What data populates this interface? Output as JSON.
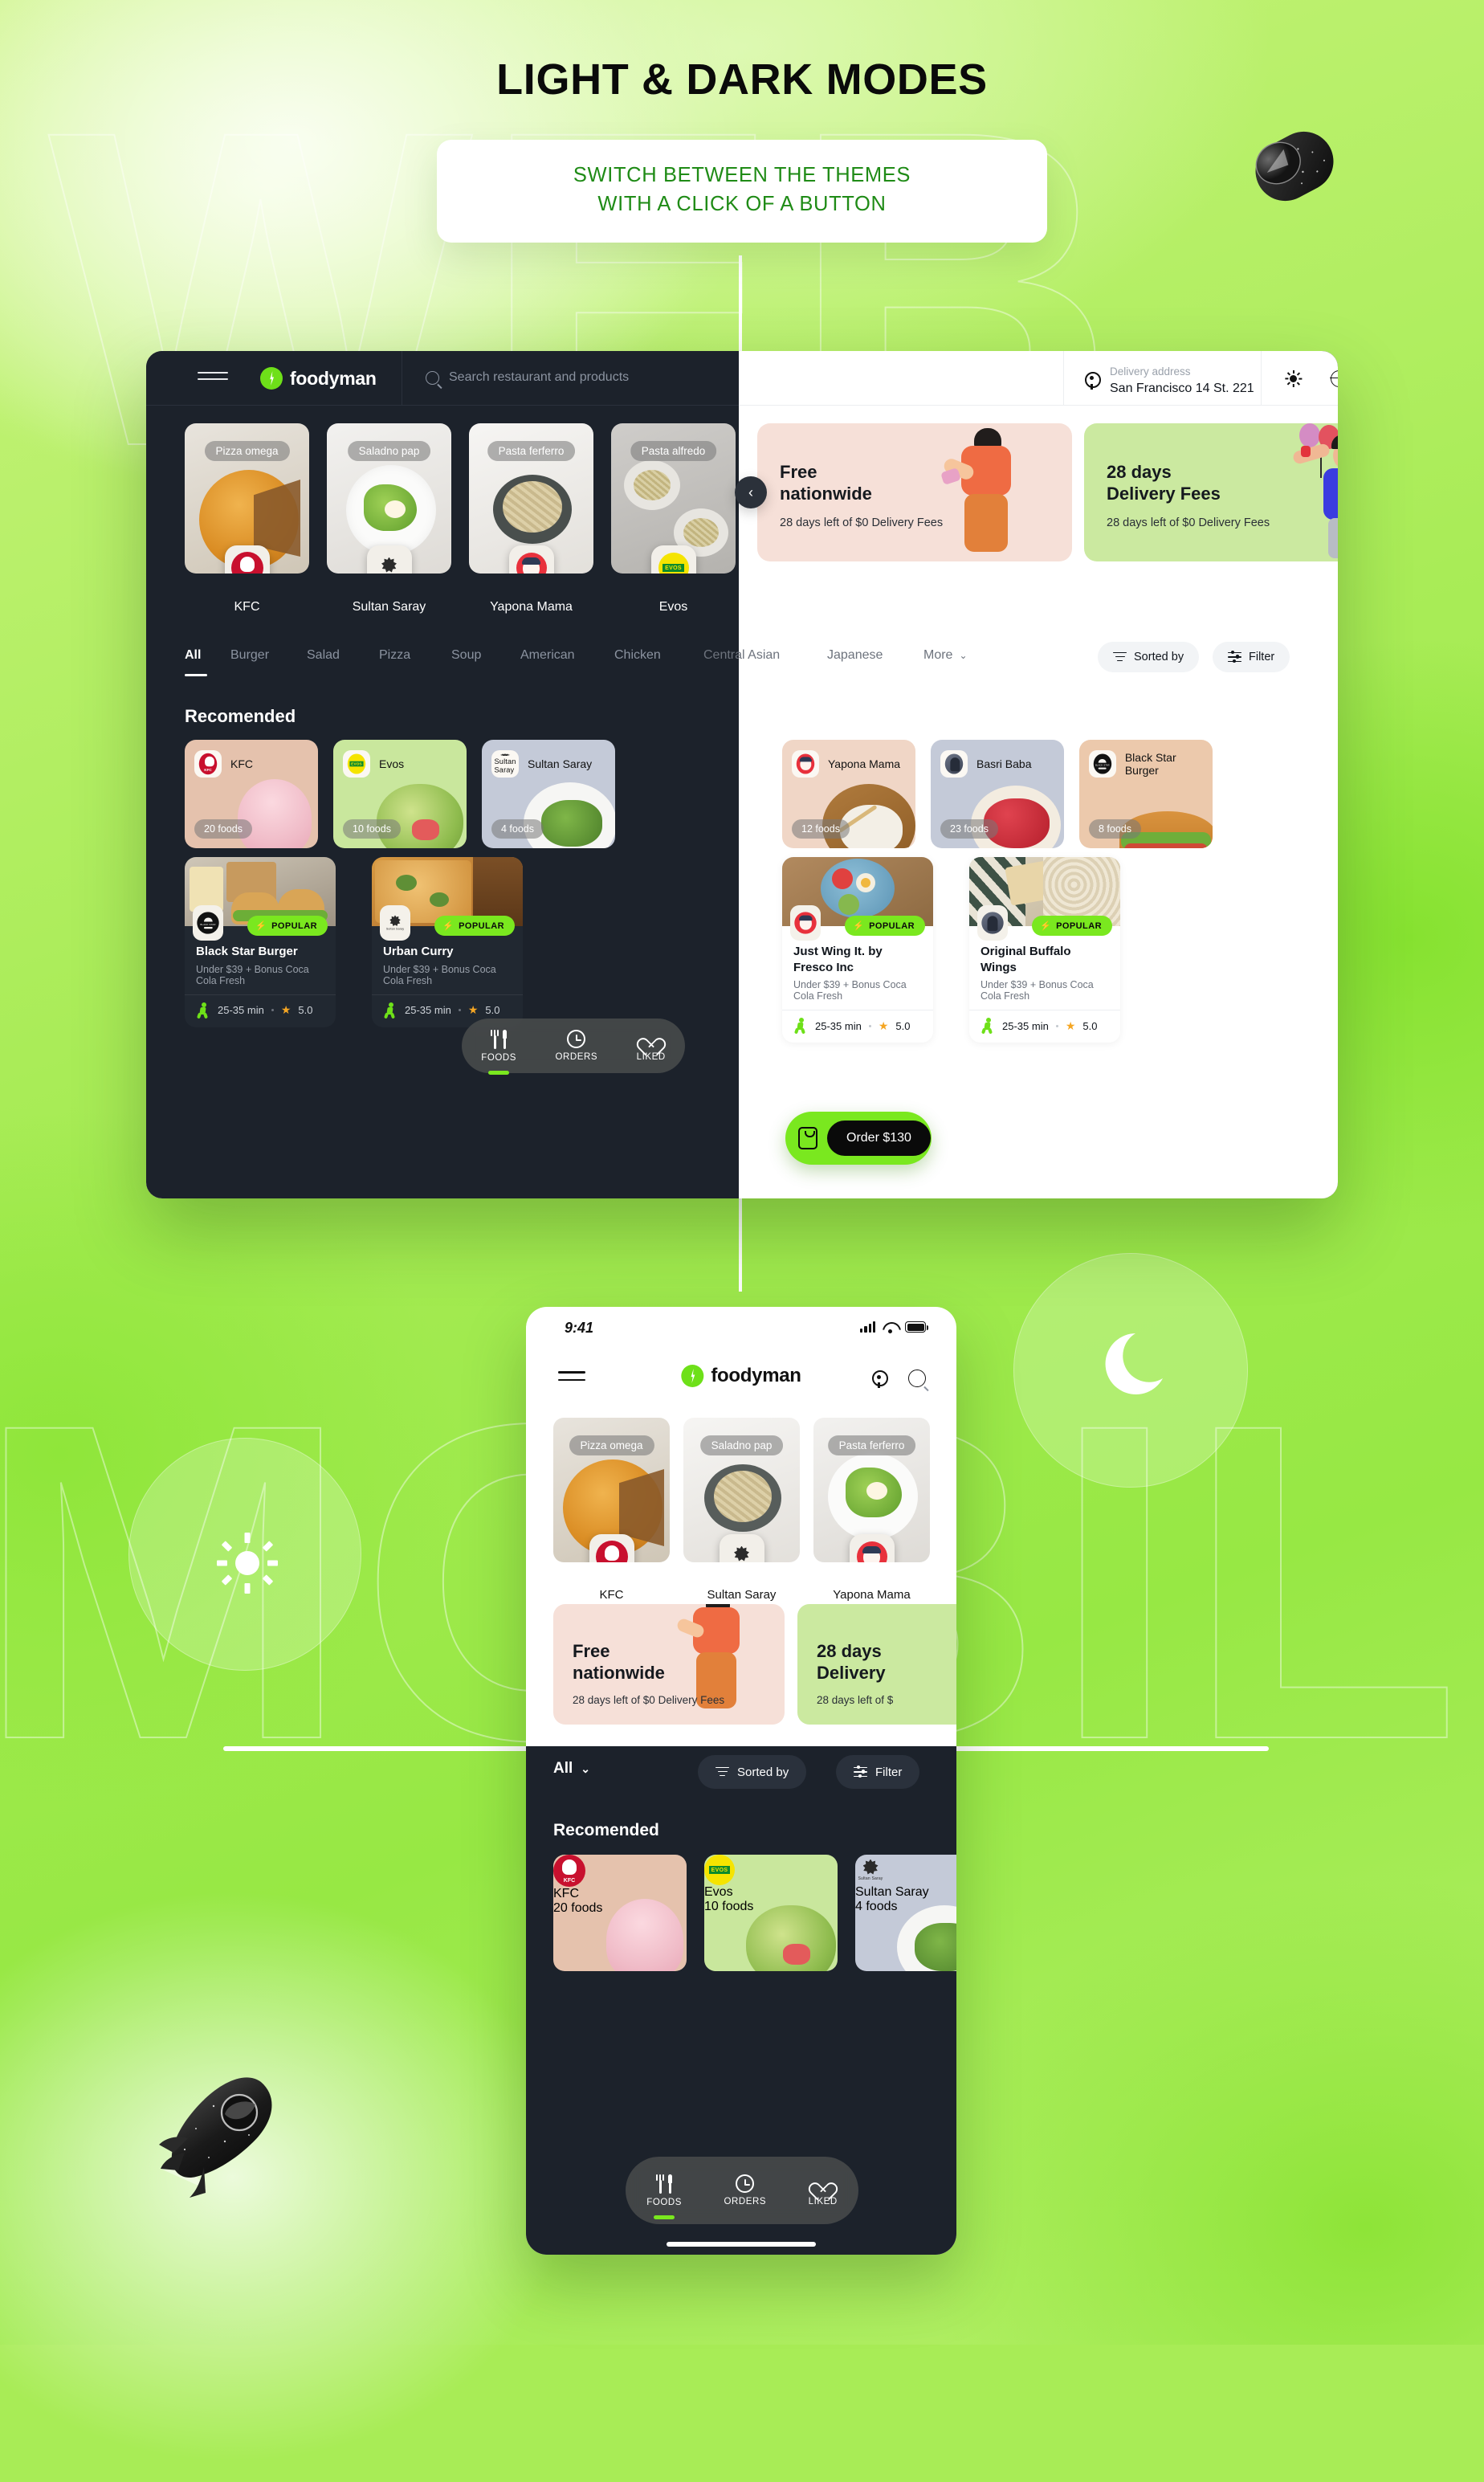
{
  "hero": {
    "title": "LIGHT & DARK MODES",
    "subtitle_line1": "SWITCH BETWEEN THE THEMES",
    "subtitle_line2": "WITH A CLICK OF A BUTTON"
  },
  "background": {
    "watermark_top": "WEB",
    "watermark_bottom": "MOBILE",
    "accent_green": "#7ae81f",
    "bg_green": "#a8ec56",
    "dark_surface": "#1c222b"
  },
  "desktop": {
    "brand": "foodyman",
    "search": {
      "placeholder": "Search restaurant and products"
    },
    "delivery": {
      "label": "Delivery address",
      "value": "San Francisco 14 St. 221"
    },
    "stories": [
      {
        "chip": "Pizza omega",
        "name": "KFC",
        "logo": "kfc-logo"
      },
      {
        "chip": "Saladno pap",
        "name": "Sultan Saray",
        "logo": "sultan-saray-logo"
      },
      {
        "chip": "Pasta ferferro",
        "name": "Yapona Mama",
        "logo": "yapona-mama-logo"
      },
      {
        "chip": "Pasta alfredo",
        "name": "Evos",
        "logo": "evos-logo"
      }
    ],
    "banners": [
      {
        "title_line1": "Free",
        "title_line2": "nationwide",
        "subtitle": "28 days left of $0 Delivery Fees",
        "color": "#f6e0d8"
      },
      {
        "title_line1": "28 days",
        "title_line2": "Delivery Fees",
        "subtitle": "28 days left of $0 Delivery Fees",
        "color": "#cbe9a0"
      }
    ],
    "banner_prev": "‹",
    "banner_next": "›",
    "categories": [
      "All",
      "Burger",
      "Salad",
      "Pizza",
      "Soup",
      "American",
      "Chicken",
      "Central Asian",
      "Japanese"
    ],
    "more_label": "More",
    "sorted_by_label": "Sorted by",
    "filter_label": "Filter",
    "recommended_title": "Recomended",
    "recommended": [
      {
        "name": "KFC",
        "foods": "20 foods",
        "color": "#e5c2ad",
        "logo": "kfc-logo"
      },
      {
        "name": "Evos",
        "foods": "10 foods",
        "color": "#c9e79d",
        "logo": "evos-logo"
      },
      {
        "name": "Sultan Saray",
        "foods": "4 foods",
        "color": "#c4cad8",
        "logo": "sultan-saray-logo"
      },
      {
        "name": "Yapona Mama",
        "foods": "12 foods",
        "color": "#f0d6c6",
        "logo": "yapona-mama-logo"
      },
      {
        "name": "Basri Baba",
        "foods": "23 foods",
        "color": "#c4cad8",
        "logo": "basri-baba-logo"
      },
      {
        "name": "Black Star Burger",
        "foods": "8 foods",
        "color": "#ecc9ac",
        "logo": "black-star-burger-logo"
      }
    ],
    "restaurants": [
      {
        "name": "Black Star Burger",
        "desc": "Under $39 + Bonus Coca Cola Fresh",
        "badge": "POPULAR",
        "time": "25-35 min",
        "rating": "5.0",
        "logo": "black-star-burger-logo",
        "theme": "dark"
      },
      {
        "name": "Urban Curry",
        "desc": "Under $39 + Bonus Coca Cola Fresh",
        "badge": "POPULAR",
        "time": "25-35 min",
        "rating": "5.0",
        "logo": "sultan-saray-logo",
        "theme": "dark"
      },
      {
        "name": "Just Wing It. by Fresco Inc",
        "desc": "Under $39 + Bonus Coca Cola Fresh",
        "badge": "POPULAR",
        "time": "25-35 min",
        "rating": "5.0",
        "logo": "yapona-mama-logo",
        "theme": "light"
      },
      {
        "name": "Original Buffalo Wings",
        "desc": "Under $39 + Bonus Coca Cola Fresh",
        "badge": "POPULAR",
        "time": "25-35 min",
        "rating": "5.0",
        "logo": "basri-baba-logo",
        "theme": "light"
      }
    ],
    "bottom_nav": [
      {
        "label": "FOODS",
        "icon": "fork-knife-icon",
        "active": true
      },
      {
        "label": "ORDERS",
        "icon": "history-clock-icon",
        "active": false
      },
      {
        "label": "LIKED",
        "icon": "heart-icon",
        "active": false
      }
    ],
    "order_button": {
      "label": "Order $130",
      "icon": "shopping-bag-icon"
    }
  },
  "mobile": {
    "status": {
      "time": "9:41",
      "signal": "signal-icon",
      "wifi": "wifi-icon",
      "battery": "battery-icon"
    },
    "brand": "foodyman",
    "header_icons": [
      "location-pin-icon",
      "search-icon"
    ],
    "stories": [
      {
        "chip": "Pizza omega",
        "name": "KFC",
        "logo": "kfc-logo"
      },
      {
        "chip": "Saladno pap",
        "name": "Sultan Saray",
        "logo": "sultan-saray-logo"
      },
      {
        "chip": "Pasta ferferro",
        "name": "Yapona Mama",
        "logo": "yapona-mama-logo"
      }
    ],
    "banners": [
      {
        "title_line1": "Free",
        "title_line2": "nationwide",
        "subtitle": "28 days left of $0 Delivery Fees",
        "color": "#f6e0d8"
      },
      {
        "title_line1": "28 days",
        "title_line2": "Delivery",
        "subtitle": "28 days left of $",
        "color": "#cbe9a0"
      }
    ],
    "all_label": "All",
    "sorted_by_label": "Sorted by",
    "filter_label": "Filter",
    "recommended_title": "Recomended",
    "recommended": [
      {
        "name": "KFC",
        "foods": "20 foods",
        "color": "#e5c2ad",
        "logo": "kfc-logo"
      },
      {
        "name": "Evos",
        "foods": "10 foods",
        "color": "#c9e79d",
        "logo": "evos-logo"
      },
      {
        "name": "Sultan Saray",
        "foods": "4 foods",
        "color": "#c4cad8",
        "logo": "sultan-saray-logo"
      }
    ],
    "bottom_nav": [
      {
        "label": "FOODS",
        "icon": "fork-knife-icon",
        "active": true
      },
      {
        "label": "ORDERS",
        "icon": "history-clock-icon",
        "active": false
      },
      {
        "label": "LIKED",
        "icon": "heart-icon",
        "active": false
      }
    ]
  }
}
